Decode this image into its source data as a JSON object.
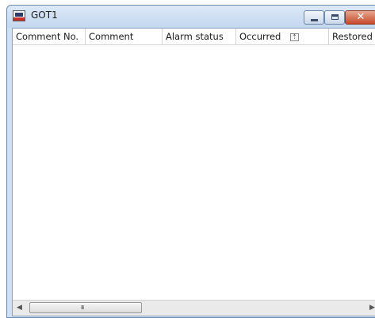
{
  "window": {
    "title": "GOT1",
    "controls": {
      "minimize_icon": "minimize-icon",
      "maximize_icon": "maximize-icon",
      "close_glyph": "✕"
    }
  },
  "list": {
    "columns": [
      {
        "label": "Comment No."
      },
      {
        "label": "Comment"
      },
      {
        "label": "Alarm status"
      },
      {
        "label": "Occurred",
        "sort_icon": "sort-indicator-icon"
      },
      {
        "label": "Restored"
      }
    ],
    "rows": []
  },
  "scrollbar": {
    "left_arrow": "◀",
    "right_arrow": "▶",
    "grip": "III"
  }
}
